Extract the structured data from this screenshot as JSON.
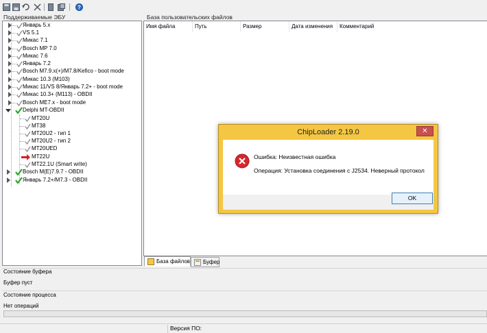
{
  "toolbar": {
    "icons": [
      "save-icon",
      "save-all-icon",
      "undo-icon",
      "cut-icon",
      "copy-icon",
      "paste-icon",
      "help-icon"
    ]
  },
  "left_pane": {
    "title": "Поддерживаемые ЭБУ",
    "items": [
      {
        "label": "Январь 5.х"
      },
      {
        "label": "VS 5.1"
      },
      {
        "label": "Микас 7.1"
      },
      {
        "label": "Bosch MP 7.0"
      },
      {
        "label": "Микас 7.6"
      },
      {
        "label": "Январь 7.2"
      },
      {
        "label": "Bosch M7.9.x(+)/M7.8/Kefico - boot mode"
      },
      {
        "label": "Микас 10.3 (M103)"
      },
      {
        "label": "Микас 11/VS 8/Январь 7.2+ - boot mode"
      },
      {
        "label": "Микас 10.3+ (M113) - OBDII"
      },
      {
        "label": "Bosch ME7.x - boot mode"
      },
      {
        "label": "Delphi MT-OBDII"
      },
      {
        "label": "MT20U"
      },
      {
        "label": "MT38"
      },
      {
        "label": "MT20U2 - тип 1"
      },
      {
        "label": "MT20U2 - тип 2"
      },
      {
        "label": "MT20UED"
      },
      {
        "label": "MT22U"
      },
      {
        "label": "MT22.1U (Smart write)"
      },
      {
        "label": "Bosch M(E)7.9.7 - OBDII"
      },
      {
        "label": "Январь 7.2+/M7.3 - OBDII"
      }
    ]
  },
  "right_pane": {
    "title": "База пользовательских файлов",
    "columns": [
      "Имя файла",
      "Путь",
      "Размер",
      "Дата изменения",
      "Комментарий"
    ],
    "tabs": [
      {
        "label": "База файлов",
        "active": true
      },
      {
        "label": "Буфер",
        "active": false
      }
    ]
  },
  "bottom": {
    "buffer_title": "Состояние буфера",
    "buffer_status": "Буфер пуст",
    "process_title": "Состояние процесса",
    "process_status": "Нет операций",
    "progress": 0
  },
  "statusbar": {
    "version_label": "Версия ПО:"
  },
  "dialog": {
    "title": "ChipLoader 2.19.0",
    "error_line": "Ошибка: Неизвестная ошибка",
    "operation_line": "Операция: Установка соединения с J2534. Неверный протокол",
    "ok_label": "OK",
    "close_label": "✕"
  },
  "colors": {
    "dialog_frame": "#f4c642",
    "error_icon": "#d8262c",
    "check_green": "#2aa52a",
    "arrow_red": "#d42020"
  }
}
